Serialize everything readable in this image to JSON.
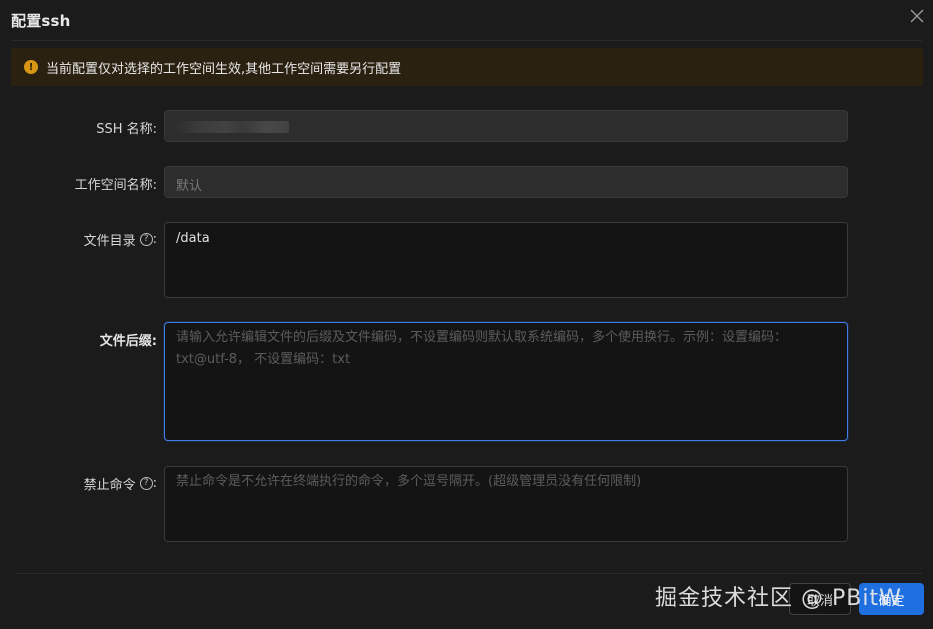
{
  "dialog": {
    "title": "配置ssh",
    "close_icon": "close-icon"
  },
  "alert": {
    "icon": "warning-icon",
    "text": "当前配置仅对选择的工作空间生效,其他工作空间需要另行配置"
  },
  "form": {
    "ssh_name": {
      "label": "SSH 名称:",
      "value_redacted": true
    },
    "workspace_name": {
      "label": "工作空间名称:",
      "value": "默认"
    },
    "file_dir": {
      "label": "文件目录",
      "label_suffix": ":",
      "help_icon": "question-circle-icon",
      "value": "/data"
    },
    "file_suffix": {
      "label": "文件后缀:",
      "placeholder": "请输入允许编辑文件的后缀及文件编码，不设置编码则默认取系统编码，多个使用换行。示例：设置编码：txt@utf-8， 不设置编码：txt"
    },
    "forbidden_cmd": {
      "label": "禁止命令",
      "label_suffix": ":",
      "help_icon": "question-circle-icon",
      "placeholder": "禁止命令是不允许在终端执行的命令，多个逗号隔开。(超级管理员没有任何限制)"
    }
  },
  "footer": {
    "cancel_label": "取消",
    "ok_label": "确定"
  },
  "watermark": {
    "text": "掘金技术社区 @ PBitW"
  },
  "colors": {
    "primary": "#1f6fe0",
    "focus_border": "#3f7ee8",
    "warning": "#d89614",
    "alert_bg": "#2b2111"
  }
}
